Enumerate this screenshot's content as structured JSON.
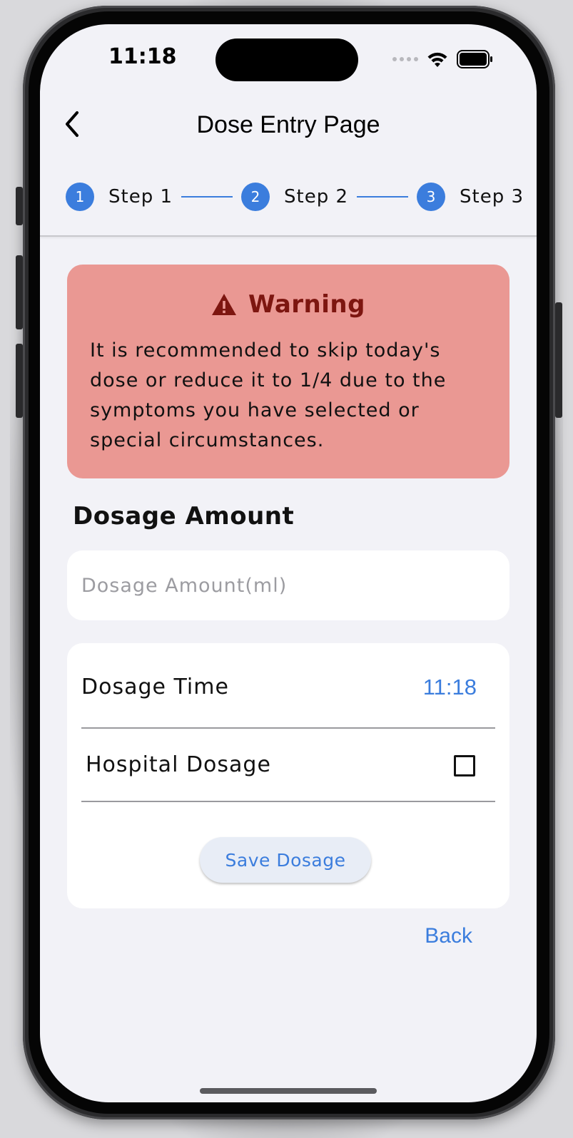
{
  "status_bar": {
    "time": "11:18"
  },
  "nav": {
    "title": "Dose Entry Page",
    "back_icon": "chevron-left-icon"
  },
  "stepper": {
    "steps": [
      {
        "number": "1",
        "label": "Step 1"
      },
      {
        "number": "2",
        "label": "Step 2"
      },
      {
        "number": "3",
        "label": "Step 3"
      }
    ]
  },
  "warning": {
    "title": "Warning",
    "icon": "warning-triangle-icon",
    "message": "It is recommended to skip today's dose or reduce it to 1/4 due to the symptoms you have selected or special circumstances."
  },
  "dosage": {
    "section_title": "Dosage Amount",
    "amount_placeholder": "Dosage Amount(ml)",
    "amount_value": "",
    "time_label": "Dosage Time",
    "time_value": "11:18",
    "hospital_label": "Hospital Dosage",
    "hospital_checked": false,
    "save_label": "Save Dosage"
  },
  "footer": {
    "back_label": "Back"
  },
  "colors": {
    "accent": "#3b7ddd",
    "warning_bg": "#ea9893",
    "warning_text": "#7d1610",
    "background": "#f2f2f7"
  }
}
